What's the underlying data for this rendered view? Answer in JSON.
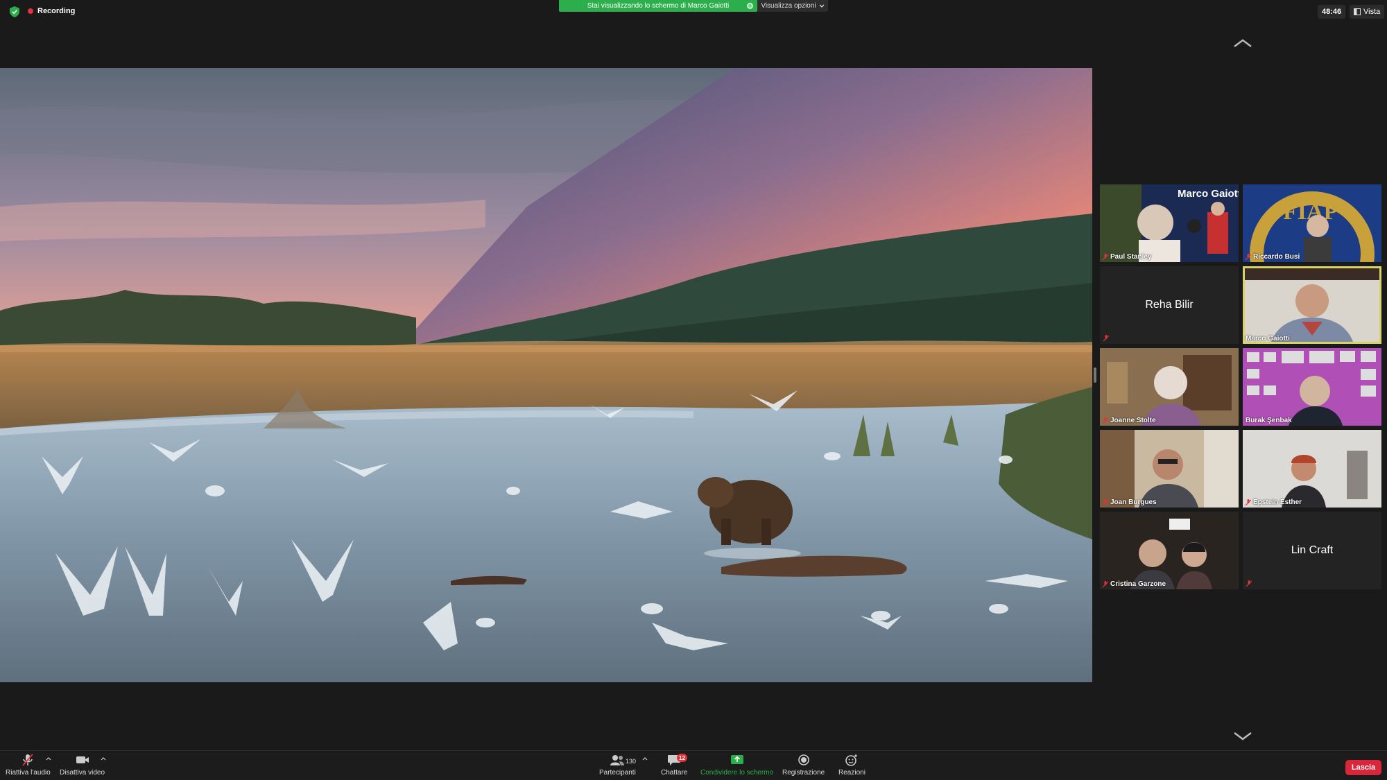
{
  "topbar": {
    "recording_label": "Recording",
    "share_banner": "Stai visualizzando lo schermo di Marco Gaiotti",
    "view_options": "Visualizza opzioni",
    "clock": "48:46",
    "view_label": "Vista"
  },
  "gallery": {
    "participants": [
      {
        "name": "Paul Stanley",
        "overlay_title": "Marco Gaiotti",
        "muted": true,
        "video": true
      },
      {
        "name": "Riccardo Busi",
        "overlay_title": "FIAP",
        "muted": true,
        "video": true
      },
      {
        "name": "Reha Bilir",
        "muted": true,
        "video": false
      },
      {
        "name": "Marco Gaiotti",
        "muted": false,
        "video": true,
        "active_speaker": true
      },
      {
        "name": "Joanne Stolte",
        "muted": true,
        "video": true
      },
      {
        "name": "Burak Şenbak",
        "muted": true,
        "video": true
      },
      {
        "name": "Joan Burgues",
        "muted": true,
        "video": true
      },
      {
        "name": "Epstein Esther",
        "muted": true,
        "video": true
      },
      {
        "name": "Cristina Garzone",
        "muted": true,
        "video": true
      },
      {
        "name": "Lin Craft",
        "muted": true,
        "video": false
      }
    ]
  },
  "toolbar": {
    "audio_label": "Riattiva l'audio",
    "video_label": "Disattiva video",
    "participants_label": "Partecipanti",
    "participants_count": "130",
    "chat_label": "Chattare",
    "chat_badge": "12",
    "share_label": "Condividere lo schermo",
    "record_label": "Registrazione",
    "reactions_label": "Reazioni",
    "leave_label": "Lascia"
  },
  "colors": {
    "accent_green": "#2dae4c",
    "active_speaker": "#d7d26a",
    "leave_red": "#d8263a",
    "badge_red": "#e0333a"
  }
}
